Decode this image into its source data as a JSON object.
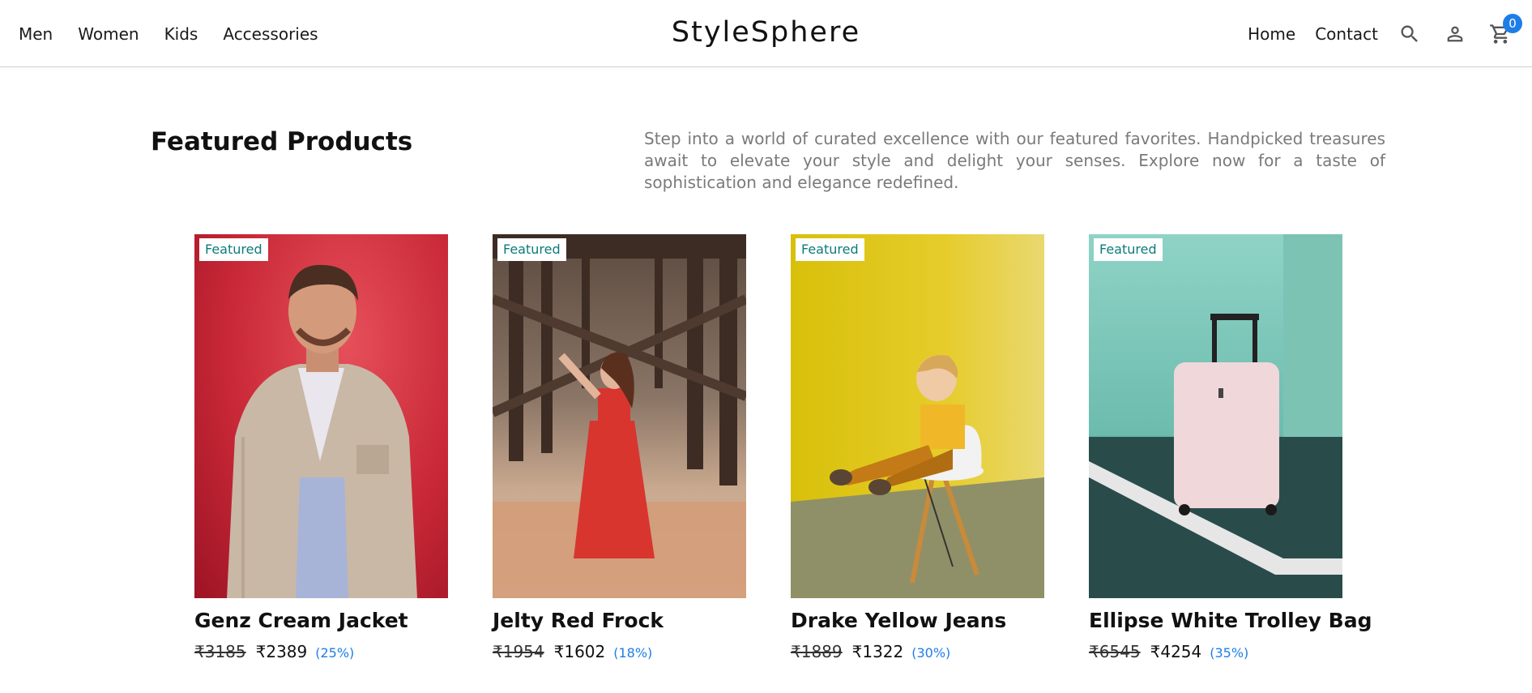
{
  "header": {
    "nav_left": [
      "Men",
      "Women",
      "Kids",
      "Accessories"
    ],
    "brand": "StyleSphere",
    "nav_right": [
      "Home",
      "Contact"
    ],
    "icons": [
      "search-icon",
      "user-icon",
      "cart-icon"
    ],
    "cart_count": "0"
  },
  "featured": {
    "title": "Featured Products",
    "description": "Step into a world of curated excellence with our featured favorites. Handpicked treasures await to elevate your style and delight your senses. Explore now for a taste of sophistication and elegance redefined."
  },
  "products": [
    {
      "badge": "Featured",
      "name": "Genz Cream Jacket",
      "old_price": "₹3185",
      "price": "₹2389",
      "discount": "(25%)"
    },
    {
      "badge": "Featured",
      "name": "Jelty Red Frock",
      "old_price": "₹1954",
      "price": "₹1602",
      "discount": "(18%)"
    },
    {
      "badge": "Featured",
      "name": "Drake Yellow Jeans",
      "old_price": "₹1889",
      "price": "₹1322",
      "discount": "(30%)"
    },
    {
      "badge": "Featured",
      "name": "Ellipse White Trolley Bag",
      "old_price": "₹6545",
      "price": "₹4254",
      "discount": "(35%)"
    }
  ],
  "colors": {
    "accent": "#1e7ee8",
    "badge_text": "#0b7b7a",
    "description_text": "#7a7a7a"
  }
}
